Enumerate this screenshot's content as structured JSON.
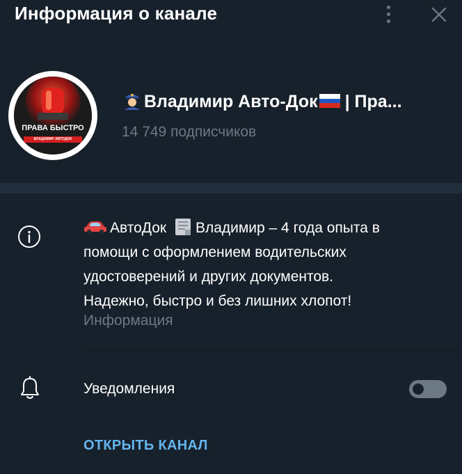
{
  "header": {
    "title": "Информация о канале"
  },
  "channel": {
    "name": "Владимир Авто-Док",
    "name_suffix": " | Пра...",
    "subscribers": "14 749 подписчиков",
    "avatar": {
      "top_text": "ПРАВА БЫСТРО",
      "bottom_text": "ВЛАДИМИР АВТОДОК"
    }
  },
  "description": {
    "line1_a": "АвтоДок",
    "line1_b": "Владимир – 4 года опыта в",
    "line2": "помощи с оформлением водительских",
    "line3": "удостоверений и других документов.",
    "line4": "Надежно, быстро и без лишних хлопот!",
    "caption": "Информация"
  },
  "notifications": {
    "label": "Уведомления",
    "enabled": false
  },
  "actions": {
    "open_channel": "ОТКРЫТЬ КАНАЛ"
  },
  "colors": {
    "background": "#17212b",
    "secondary_text": "#6c7883",
    "accent": "#64b5ef",
    "separator": "#232e3c"
  }
}
